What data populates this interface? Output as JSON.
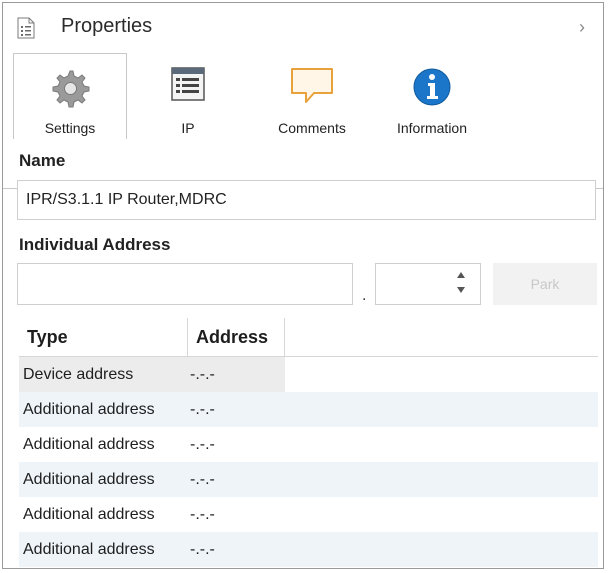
{
  "header": {
    "title": "Properties",
    "collapse_glyph": "›"
  },
  "tabs": [
    {
      "label": "Settings",
      "icon": "gear-icon",
      "active": true
    },
    {
      "label": "IP",
      "icon": "ip-window-icon",
      "active": false
    },
    {
      "label": "Comments",
      "icon": "comment-bubble-icon",
      "active": false
    },
    {
      "label": "Information",
      "icon": "info-icon",
      "active": false
    }
  ],
  "name_section": {
    "label": "Name",
    "value": "IPR/S3.1.1 IP Router,MDRC"
  },
  "address_section": {
    "label": "Individual Address",
    "main_value": "",
    "dot": ".",
    "spin_value": "",
    "park_label": "Park"
  },
  "table": {
    "headers": [
      "Type",
      "Address"
    ],
    "rows": [
      {
        "type": "Device address",
        "address": "-.-.-"
      },
      {
        "type": "Additional address",
        "address": "-.-.-"
      },
      {
        "type": "Additional address",
        "address": "-.-.-"
      },
      {
        "type": "Additional address",
        "address": "-.-.-"
      },
      {
        "type": "Additional address",
        "address": "-.-.-"
      },
      {
        "type": "Additional address",
        "address": "-.-.-"
      }
    ]
  },
  "colors": {
    "info_blue": "#1b76c9",
    "comment_orange": "#e9a23b",
    "comment_fill": "#fff6e8",
    "row_alt": "#eef4f8"
  }
}
